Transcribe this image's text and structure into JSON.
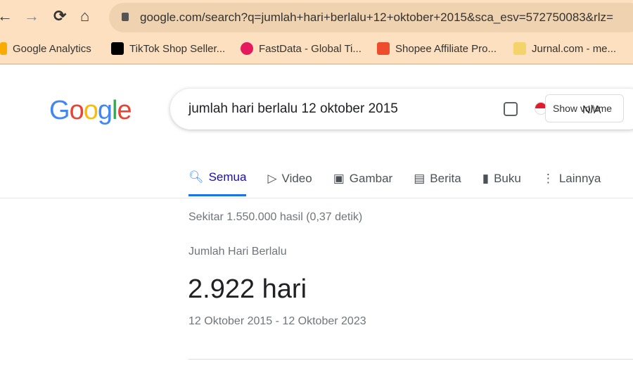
{
  "browser": {
    "url": "google.com/search?q=jumlah+hari+berlalu+12+oktober+2015&sca_esv=572750083&rlz=",
    "bookmarks": [
      {
        "label": "Google Analytics",
        "color": "#f9ab00"
      },
      {
        "label": "TikTok Shop Seller...",
        "color": "#000000"
      },
      {
        "label": "FastData - Global Ti...",
        "color": "#e5195d"
      },
      {
        "label": "Shopee Affiliate Pro...",
        "color": "#ee4d2d"
      },
      {
        "label": "Jurnal.com - me...",
        "color": "#f5d36b"
      }
    ]
  },
  "search": {
    "logo": "Google",
    "query": "jumlah hari berlalu 12 oktober 2015",
    "extension_label": "Show volume",
    "extension_value": "N/A"
  },
  "tabs": [
    {
      "label": "Semua",
      "icon": "search-icon"
    },
    {
      "label": "Video",
      "icon": "play-icon"
    },
    {
      "label": "Gambar",
      "icon": "image-icon"
    },
    {
      "label": "Berita",
      "icon": "news-icon"
    },
    {
      "label": "Buku",
      "icon": "book-icon"
    },
    {
      "label": "Lainnya",
      "icon": "more-icon"
    }
  ],
  "results": {
    "stats": "Sekitar 1.550.000 hasil (0,37 detik)",
    "answer_label": "Jumlah Hari Berlalu",
    "answer_value": "2.922 hari",
    "answer_range": "12 Oktober 2015 - 12 Oktober 2023"
  }
}
